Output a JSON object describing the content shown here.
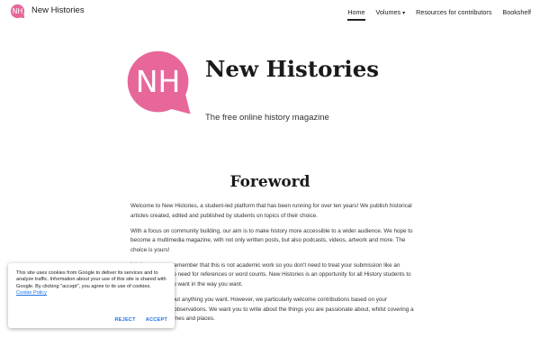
{
  "colors": {
    "brand": "#e8679b",
    "link": "#1a73e8"
  },
  "header": {
    "logo_letters": "NH",
    "site_name": "New Histories",
    "nav": [
      {
        "label": "Home",
        "active": true
      },
      {
        "label": "Volumes",
        "icon": "chevron-down-icon"
      },
      {
        "label": "Resources for contributors"
      },
      {
        "label": "Bookshelf"
      }
    ]
  },
  "hero": {
    "logo_letters": "NH",
    "title": "New Histories",
    "subtitle": "The free online history magazine"
  },
  "foreword": {
    "title": "Foreword",
    "paragraphs": [
      "Welcome to New Histories, a student-led platform that has been running for over ten years! We publish historical articles created, edited and published by students on topics of their choice.",
      "With a focus on community building, our aim is to make history more accessible to a wider audience. We hope to become a multimedia magazine, with not only written posts, but also podcasts, videos, artwork and more. The choice is yours!",
      "It is important to remember that this is not academic work so you don't need to treat your submission like an essay. There is no need for references or word counts. New Histories is an opportunity for all History students to tell the history you want in the way you want.",
      "You can write about anything you want. However, we particularly welcome contributions based on your experiences and observations. We want you to write about the things you are passionate about, whilst covering a range of topics, times and places."
    ]
  },
  "cookie_banner": {
    "text": "This site uses cookies from Google to deliver its services and to analyze traffic. Information about your use of this site is shared with Google. By clicking \"accept\", you agree to its use of cookies.",
    "link_label": "Cookie Policy",
    "reject_label": "REJECT",
    "accept_label": "ACCEPT"
  }
}
